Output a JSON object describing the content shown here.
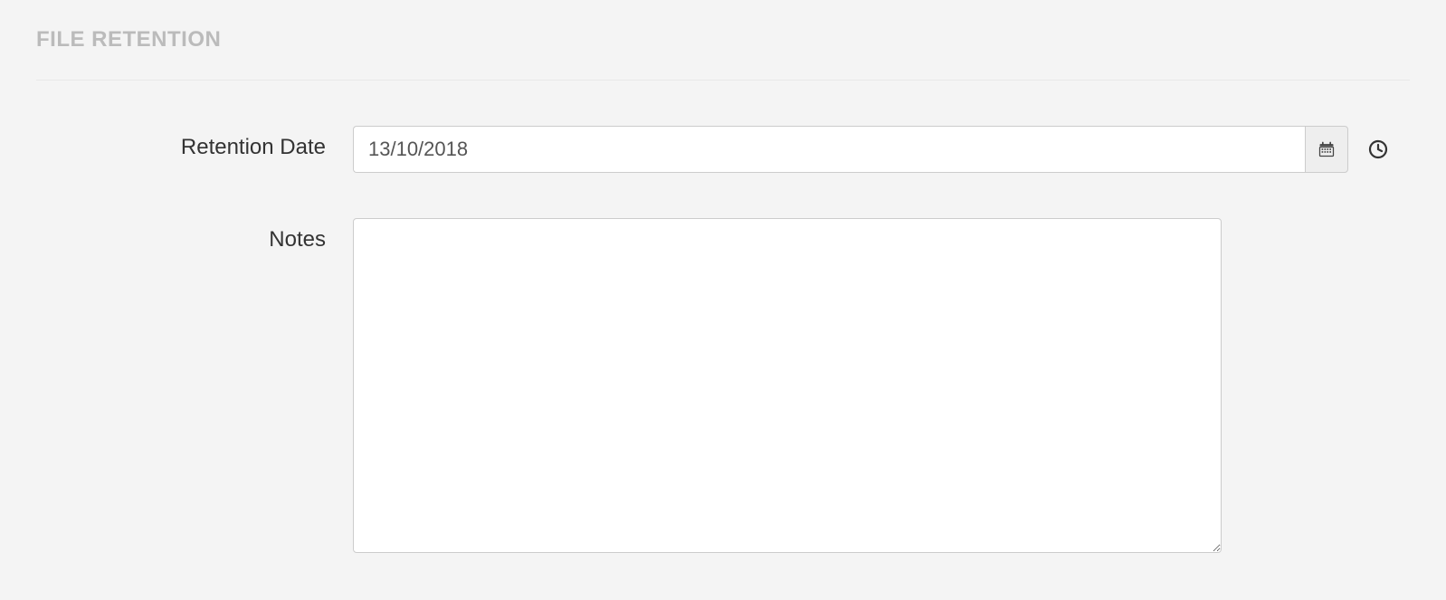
{
  "section": {
    "title": "FILE RETENTION"
  },
  "form": {
    "retention_date": {
      "label": "Retention Date",
      "value": "13/10/2018"
    },
    "notes": {
      "label": "Notes",
      "value": ""
    }
  },
  "icons": {
    "calendar": "calendar-icon",
    "clock": "clock-icon"
  }
}
